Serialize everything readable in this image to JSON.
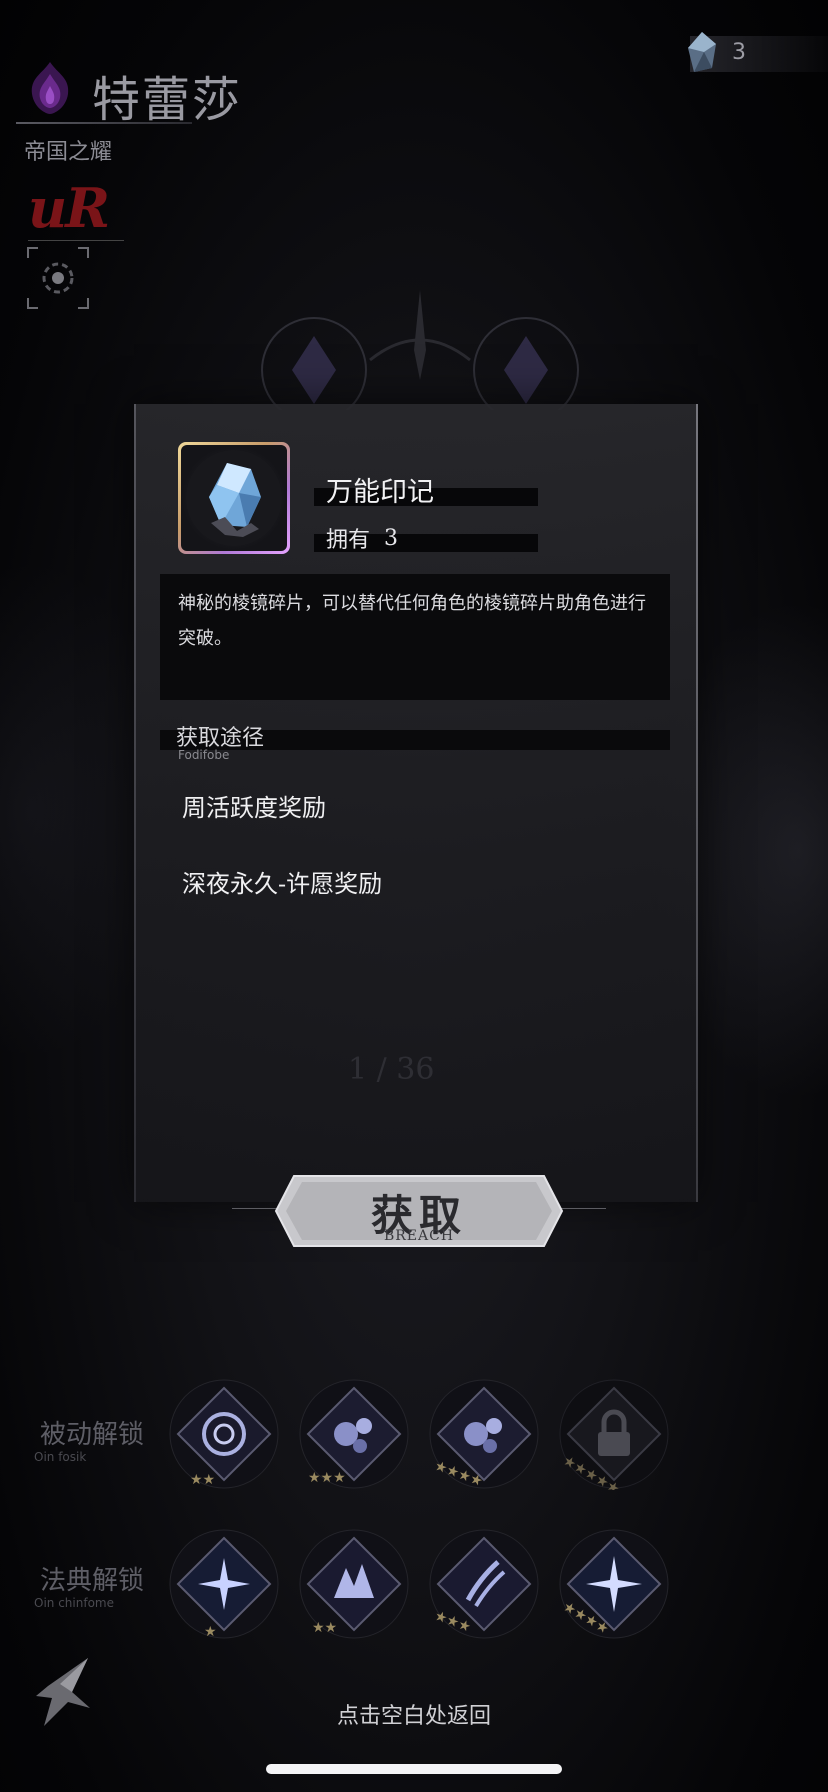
{
  "character": {
    "name": "特蕾莎",
    "title": "帝国之耀",
    "rarity": "uR"
  },
  "currency": {
    "icon": "crystal-shard-icon",
    "value": "3"
  },
  "item": {
    "icon": "blue-crystal-icon",
    "name": "万能印记",
    "own_label": "拥有",
    "own_value": "3",
    "description": "神秘的棱镜碎片，可以替代任何角色的棱镜碎片助角色进行突破。"
  },
  "acquisition": {
    "title": "获取途径",
    "subtitle": "Fodifobe",
    "sources": [
      {
        "label": "周活跃度奖励"
      },
      {
        "label": "深夜永久-许愿奖励"
      }
    ]
  },
  "background": {
    "count": "1 / 36"
  },
  "acquire_button": {
    "label": "获取",
    "sub": "BREACH"
  },
  "passive": {
    "label": "被动解锁",
    "sub": "Oin fosik"
  },
  "codex": {
    "label": "法典解锁",
    "sub": "Oin chinfome"
  },
  "hint": "点击空白处返回",
  "colors": {
    "rarity": "#7a1418",
    "item_frame_gold": "#f0d99a",
    "item_frame_purple": "#b07ad6",
    "crystal": "#8fd0ff"
  }
}
